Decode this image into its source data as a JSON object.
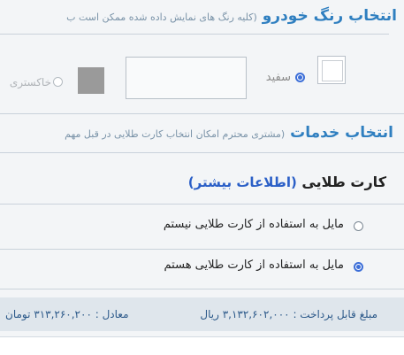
{
  "color_section": {
    "title": "انتخاب رنگ خودرو",
    "note": "(کلیه رنگ های نمایش داده شده ممکن است ب",
    "options": [
      {
        "label": "سفید",
        "selected": true,
        "swatch": "#ffffff"
      },
      {
        "label": "خاکستری",
        "selected": false,
        "swatch": "#9a9a9a"
      }
    ]
  },
  "services_section": {
    "title": "انتخاب خدمات",
    "note": "(مشتری محترم امکان انتخاب کارت طلایی در قبل مهم"
  },
  "golden_card": {
    "title": "کارت طلایی",
    "more_info_link": "(اطلاعات بیشتر)",
    "options": [
      {
        "label": "مایل به استفاده از کارت طلایی نیستم",
        "selected": false
      },
      {
        "label": "مایل به استفاده از کارت طلایی هستم",
        "selected": true
      }
    ]
  },
  "payment": {
    "amount_label": "مبلغ قابل پرداخت :",
    "amount_value": "۳,۱۳۲,۶۰۲,۰۰۰ ریال",
    "equivalent_label": "معادل :",
    "equivalent_value": "۳۱۳,۲۶۰,۲۰۰ تومان"
  },
  "colors": {
    "accent_blue": "#2f7fc0",
    "link_blue": "#2b5fc7",
    "radio_blue": "#3d6fd8"
  }
}
